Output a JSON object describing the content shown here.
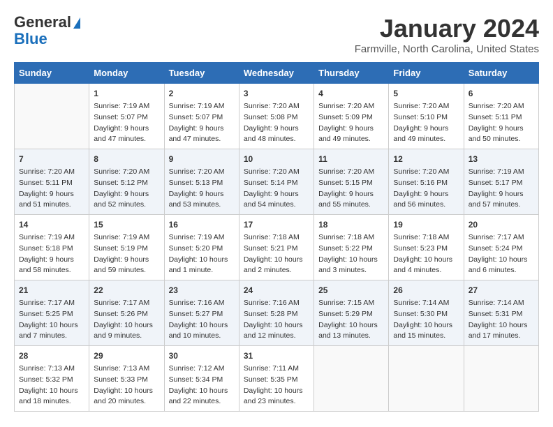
{
  "header": {
    "logo_line1": "General",
    "logo_line2": "Blue",
    "month": "January 2024",
    "location": "Farmville, North Carolina, United States"
  },
  "days_of_week": [
    "Sunday",
    "Monday",
    "Tuesday",
    "Wednesday",
    "Thursday",
    "Friday",
    "Saturday"
  ],
  "weeks": [
    [
      {
        "day": "",
        "info": ""
      },
      {
        "day": "1",
        "info": "Sunrise: 7:19 AM\nSunset: 5:07 PM\nDaylight: 9 hours\nand 47 minutes."
      },
      {
        "day": "2",
        "info": "Sunrise: 7:19 AM\nSunset: 5:07 PM\nDaylight: 9 hours\nand 47 minutes."
      },
      {
        "day": "3",
        "info": "Sunrise: 7:20 AM\nSunset: 5:08 PM\nDaylight: 9 hours\nand 48 minutes."
      },
      {
        "day": "4",
        "info": "Sunrise: 7:20 AM\nSunset: 5:09 PM\nDaylight: 9 hours\nand 49 minutes."
      },
      {
        "day": "5",
        "info": "Sunrise: 7:20 AM\nSunset: 5:10 PM\nDaylight: 9 hours\nand 49 minutes."
      },
      {
        "day": "6",
        "info": "Sunrise: 7:20 AM\nSunset: 5:11 PM\nDaylight: 9 hours\nand 50 minutes."
      }
    ],
    [
      {
        "day": "7",
        "info": "Sunrise: 7:20 AM\nSunset: 5:11 PM\nDaylight: 9 hours\nand 51 minutes."
      },
      {
        "day": "8",
        "info": "Sunrise: 7:20 AM\nSunset: 5:12 PM\nDaylight: 9 hours\nand 52 minutes."
      },
      {
        "day": "9",
        "info": "Sunrise: 7:20 AM\nSunset: 5:13 PM\nDaylight: 9 hours\nand 53 minutes."
      },
      {
        "day": "10",
        "info": "Sunrise: 7:20 AM\nSunset: 5:14 PM\nDaylight: 9 hours\nand 54 minutes."
      },
      {
        "day": "11",
        "info": "Sunrise: 7:20 AM\nSunset: 5:15 PM\nDaylight: 9 hours\nand 55 minutes."
      },
      {
        "day": "12",
        "info": "Sunrise: 7:20 AM\nSunset: 5:16 PM\nDaylight: 9 hours\nand 56 minutes."
      },
      {
        "day": "13",
        "info": "Sunrise: 7:19 AM\nSunset: 5:17 PM\nDaylight: 9 hours\nand 57 minutes."
      }
    ],
    [
      {
        "day": "14",
        "info": "Sunrise: 7:19 AM\nSunset: 5:18 PM\nDaylight: 9 hours\nand 58 minutes."
      },
      {
        "day": "15",
        "info": "Sunrise: 7:19 AM\nSunset: 5:19 PM\nDaylight: 9 hours\nand 59 minutes."
      },
      {
        "day": "16",
        "info": "Sunrise: 7:19 AM\nSunset: 5:20 PM\nDaylight: 10 hours\nand 1 minute."
      },
      {
        "day": "17",
        "info": "Sunrise: 7:18 AM\nSunset: 5:21 PM\nDaylight: 10 hours\nand 2 minutes."
      },
      {
        "day": "18",
        "info": "Sunrise: 7:18 AM\nSunset: 5:22 PM\nDaylight: 10 hours\nand 3 minutes."
      },
      {
        "day": "19",
        "info": "Sunrise: 7:18 AM\nSunset: 5:23 PM\nDaylight: 10 hours\nand 4 minutes."
      },
      {
        "day": "20",
        "info": "Sunrise: 7:17 AM\nSunset: 5:24 PM\nDaylight: 10 hours\nand 6 minutes."
      }
    ],
    [
      {
        "day": "21",
        "info": "Sunrise: 7:17 AM\nSunset: 5:25 PM\nDaylight: 10 hours\nand 7 minutes."
      },
      {
        "day": "22",
        "info": "Sunrise: 7:17 AM\nSunset: 5:26 PM\nDaylight: 10 hours\nand 9 minutes."
      },
      {
        "day": "23",
        "info": "Sunrise: 7:16 AM\nSunset: 5:27 PM\nDaylight: 10 hours\nand 10 minutes."
      },
      {
        "day": "24",
        "info": "Sunrise: 7:16 AM\nSunset: 5:28 PM\nDaylight: 10 hours\nand 12 minutes."
      },
      {
        "day": "25",
        "info": "Sunrise: 7:15 AM\nSunset: 5:29 PM\nDaylight: 10 hours\nand 13 minutes."
      },
      {
        "day": "26",
        "info": "Sunrise: 7:14 AM\nSunset: 5:30 PM\nDaylight: 10 hours\nand 15 minutes."
      },
      {
        "day": "27",
        "info": "Sunrise: 7:14 AM\nSunset: 5:31 PM\nDaylight: 10 hours\nand 17 minutes."
      }
    ],
    [
      {
        "day": "28",
        "info": "Sunrise: 7:13 AM\nSunset: 5:32 PM\nDaylight: 10 hours\nand 18 minutes."
      },
      {
        "day": "29",
        "info": "Sunrise: 7:13 AM\nSunset: 5:33 PM\nDaylight: 10 hours\nand 20 minutes."
      },
      {
        "day": "30",
        "info": "Sunrise: 7:12 AM\nSunset: 5:34 PM\nDaylight: 10 hours\nand 22 minutes."
      },
      {
        "day": "31",
        "info": "Sunrise: 7:11 AM\nSunset: 5:35 PM\nDaylight: 10 hours\nand 23 minutes."
      },
      {
        "day": "",
        "info": ""
      },
      {
        "day": "",
        "info": ""
      },
      {
        "day": "",
        "info": ""
      }
    ]
  ]
}
